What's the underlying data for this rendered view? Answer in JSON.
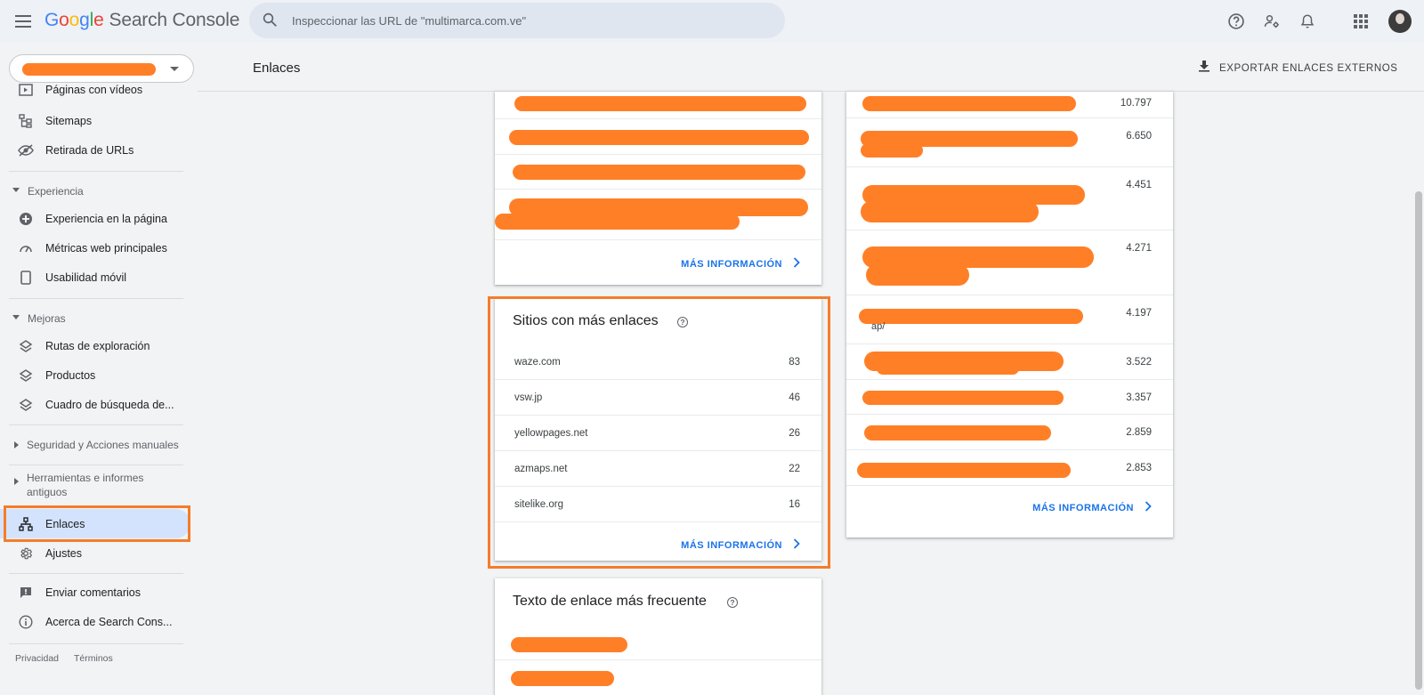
{
  "app": {
    "logo_letters": [
      "G",
      "o",
      "o",
      "g",
      "l",
      "e"
    ],
    "product": "Search Console",
    "search_placeholder": "Inspeccionar las URL de \"multimarca.com.ve\""
  },
  "topbar_icons": [
    "help-icon",
    "manage-users-icon",
    "notifications-icon",
    "apps-grid-icon"
  ],
  "sidebar": {
    "items_top": [
      {
        "label": "Páginas con vídeos",
        "icon": "video-pages-icon"
      },
      {
        "label": "Sitemaps",
        "icon": "sitemap-icon"
      },
      {
        "label": "Retirada de URLs",
        "icon": "url-removal-icon"
      }
    ],
    "experiencia": {
      "title": "Experiencia",
      "items": [
        {
          "label": "Experiencia en la página",
          "icon": "page-experience-icon"
        },
        {
          "label": "Métricas web principales",
          "icon": "core-web-vitals-icon"
        },
        {
          "label": "Usabilidad móvil",
          "icon": "mobile-icon"
        }
      ]
    },
    "mejoras": {
      "title": "Mejoras",
      "items": [
        {
          "label": "Rutas de exploración",
          "icon": "layers-icon"
        },
        {
          "label": "Productos",
          "icon": "layers-icon"
        },
        {
          "label": "Cuadro de búsqueda de...",
          "icon": "layers-icon"
        }
      ]
    },
    "seguridad": "Seguridad y Acciones manuales",
    "herramientas": "Herramientas e informes antiguos",
    "enlaces": "Enlaces",
    "ajustes": "Ajustes",
    "enviar": "Enviar comentarios",
    "acerca": "Acerca de Search Cons...",
    "footer": {
      "privacy": "Privacidad",
      "terms": "Términos"
    }
  },
  "header": {
    "title": "Enlaces",
    "export_label": "EXPORTAR ENLACES EXTERNOS"
  },
  "more_label": "MÁS INFORMACIÓN",
  "top_sites": {
    "title": "Sitios con más enlaces",
    "help": "?",
    "rows": [
      {
        "site": "waze.com",
        "count": "83"
      },
      {
        "site": "vsw.jp",
        "count": "46"
      },
      {
        "site": "yellowpages.net",
        "count": "26"
      },
      {
        "site": "azmaps.net",
        "count": "22"
      },
      {
        "site": "sitelike.org",
        "count": "16"
      }
    ]
  },
  "anchor_text": {
    "title": "Texto de enlace más frecuente",
    "help": "?"
  },
  "right_card": {
    "counts": [
      "10.797",
      "6.650",
      "4.451",
      "4.271",
      "4.197",
      "3.522",
      "3.357",
      "2.859",
      "2.853"
    ],
    "visible_fragment": "ap/"
  },
  "colors": {
    "redaction": "#ff7f27",
    "highlight": "#f57c2b",
    "link_blue": "#1a73e8",
    "active_nav": "#d3e3fd"
  }
}
